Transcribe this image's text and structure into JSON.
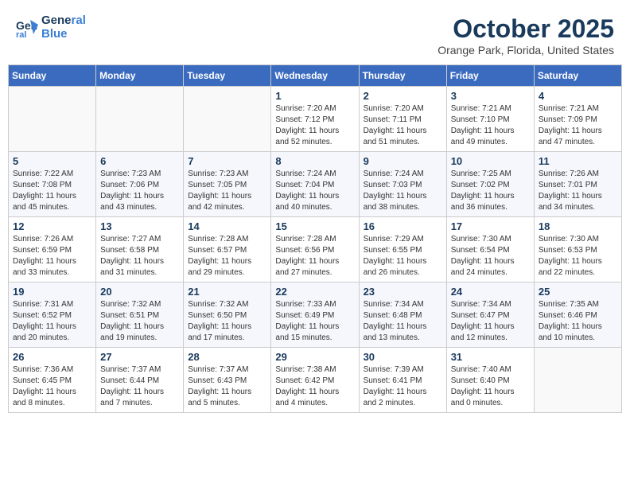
{
  "header": {
    "logo_line1": "General",
    "logo_line2": "Blue",
    "month": "October 2025",
    "location": "Orange Park, Florida, United States"
  },
  "weekdays": [
    "Sunday",
    "Monday",
    "Tuesday",
    "Wednesday",
    "Thursday",
    "Friday",
    "Saturday"
  ],
  "weeks": [
    [
      {
        "day": "",
        "info": ""
      },
      {
        "day": "",
        "info": ""
      },
      {
        "day": "",
        "info": ""
      },
      {
        "day": "1",
        "info": "Sunrise: 7:20 AM\nSunset: 7:12 PM\nDaylight: 11 hours\nand 52 minutes."
      },
      {
        "day": "2",
        "info": "Sunrise: 7:20 AM\nSunset: 7:11 PM\nDaylight: 11 hours\nand 51 minutes."
      },
      {
        "day": "3",
        "info": "Sunrise: 7:21 AM\nSunset: 7:10 PM\nDaylight: 11 hours\nand 49 minutes."
      },
      {
        "day": "4",
        "info": "Sunrise: 7:21 AM\nSunset: 7:09 PM\nDaylight: 11 hours\nand 47 minutes."
      }
    ],
    [
      {
        "day": "5",
        "info": "Sunrise: 7:22 AM\nSunset: 7:08 PM\nDaylight: 11 hours\nand 45 minutes."
      },
      {
        "day": "6",
        "info": "Sunrise: 7:23 AM\nSunset: 7:06 PM\nDaylight: 11 hours\nand 43 minutes."
      },
      {
        "day": "7",
        "info": "Sunrise: 7:23 AM\nSunset: 7:05 PM\nDaylight: 11 hours\nand 42 minutes."
      },
      {
        "day": "8",
        "info": "Sunrise: 7:24 AM\nSunset: 7:04 PM\nDaylight: 11 hours\nand 40 minutes."
      },
      {
        "day": "9",
        "info": "Sunrise: 7:24 AM\nSunset: 7:03 PM\nDaylight: 11 hours\nand 38 minutes."
      },
      {
        "day": "10",
        "info": "Sunrise: 7:25 AM\nSunset: 7:02 PM\nDaylight: 11 hours\nand 36 minutes."
      },
      {
        "day": "11",
        "info": "Sunrise: 7:26 AM\nSunset: 7:01 PM\nDaylight: 11 hours\nand 34 minutes."
      }
    ],
    [
      {
        "day": "12",
        "info": "Sunrise: 7:26 AM\nSunset: 6:59 PM\nDaylight: 11 hours\nand 33 minutes."
      },
      {
        "day": "13",
        "info": "Sunrise: 7:27 AM\nSunset: 6:58 PM\nDaylight: 11 hours\nand 31 minutes."
      },
      {
        "day": "14",
        "info": "Sunrise: 7:28 AM\nSunset: 6:57 PM\nDaylight: 11 hours\nand 29 minutes."
      },
      {
        "day": "15",
        "info": "Sunrise: 7:28 AM\nSunset: 6:56 PM\nDaylight: 11 hours\nand 27 minutes."
      },
      {
        "day": "16",
        "info": "Sunrise: 7:29 AM\nSunset: 6:55 PM\nDaylight: 11 hours\nand 26 minutes."
      },
      {
        "day": "17",
        "info": "Sunrise: 7:30 AM\nSunset: 6:54 PM\nDaylight: 11 hours\nand 24 minutes."
      },
      {
        "day": "18",
        "info": "Sunrise: 7:30 AM\nSunset: 6:53 PM\nDaylight: 11 hours\nand 22 minutes."
      }
    ],
    [
      {
        "day": "19",
        "info": "Sunrise: 7:31 AM\nSunset: 6:52 PM\nDaylight: 11 hours\nand 20 minutes."
      },
      {
        "day": "20",
        "info": "Sunrise: 7:32 AM\nSunset: 6:51 PM\nDaylight: 11 hours\nand 19 minutes."
      },
      {
        "day": "21",
        "info": "Sunrise: 7:32 AM\nSunset: 6:50 PM\nDaylight: 11 hours\nand 17 minutes."
      },
      {
        "day": "22",
        "info": "Sunrise: 7:33 AM\nSunset: 6:49 PM\nDaylight: 11 hours\nand 15 minutes."
      },
      {
        "day": "23",
        "info": "Sunrise: 7:34 AM\nSunset: 6:48 PM\nDaylight: 11 hours\nand 13 minutes."
      },
      {
        "day": "24",
        "info": "Sunrise: 7:34 AM\nSunset: 6:47 PM\nDaylight: 11 hours\nand 12 minutes."
      },
      {
        "day": "25",
        "info": "Sunrise: 7:35 AM\nSunset: 6:46 PM\nDaylight: 11 hours\nand 10 minutes."
      }
    ],
    [
      {
        "day": "26",
        "info": "Sunrise: 7:36 AM\nSunset: 6:45 PM\nDaylight: 11 hours\nand 8 minutes."
      },
      {
        "day": "27",
        "info": "Sunrise: 7:37 AM\nSunset: 6:44 PM\nDaylight: 11 hours\nand 7 minutes."
      },
      {
        "day": "28",
        "info": "Sunrise: 7:37 AM\nSunset: 6:43 PM\nDaylight: 11 hours\nand 5 minutes."
      },
      {
        "day": "29",
        "info": "Sunrise: 7:38 AM\nSunset: 6:42 PM\nDaylight: 11 hours\nand 4 minutes."
      },
      {
        "day": "30",
        "info": "Sunrise: 7:39 AM\nSunset: 6:41 PM\nDaylight: 11 hours\nand 2 minutes."
      },
      {
        "day": "31",
        "info": "Sunrise: 7:40 AM\nSunset: 6:40 PM\nDaylight: 11 hours\nand 0 minutes."
      },
      {
        "day": "",
        "info": ""
      }
    ]
  ]
}
